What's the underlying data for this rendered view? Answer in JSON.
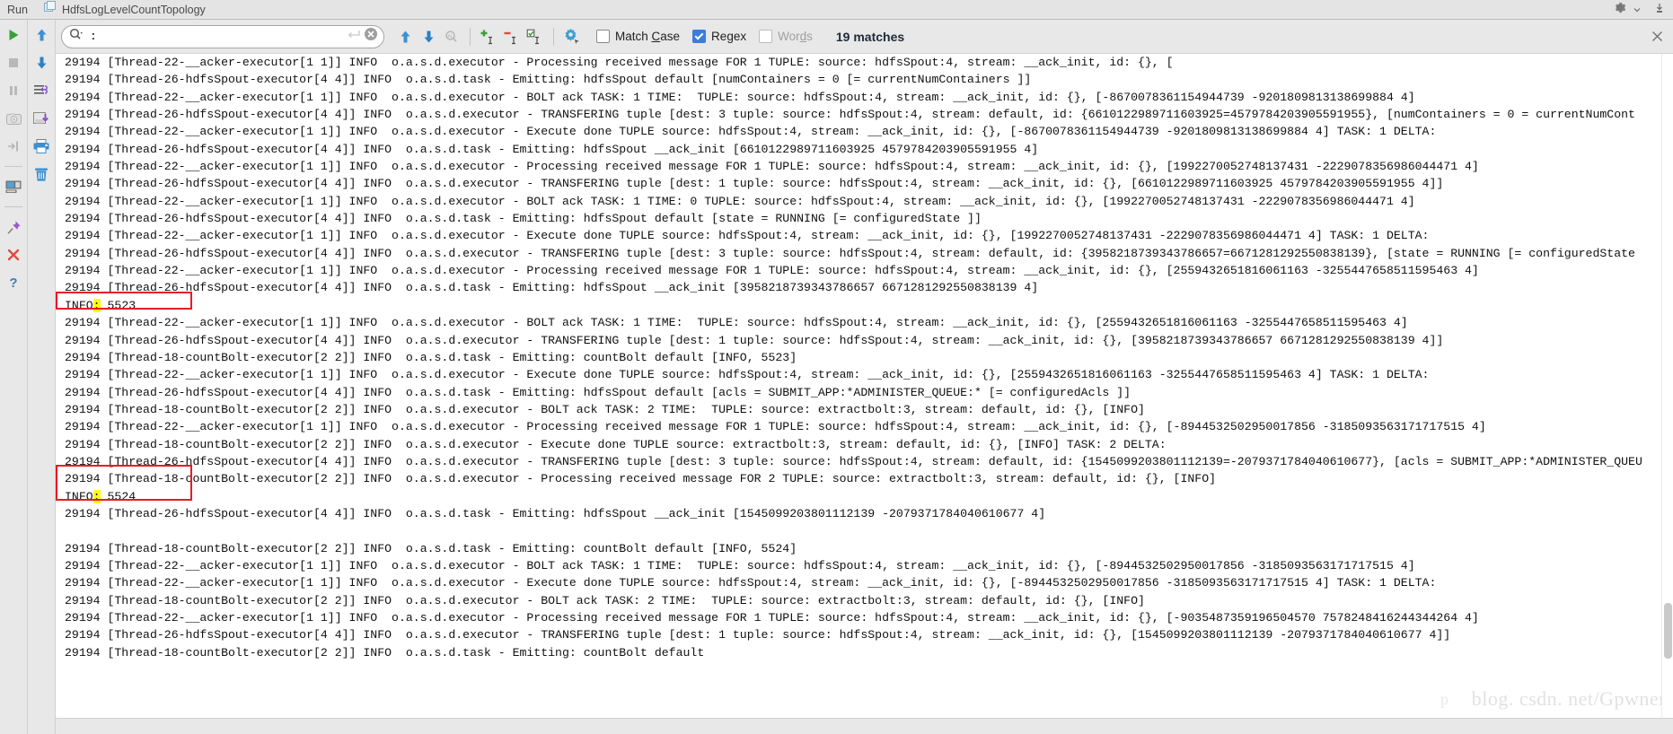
{
  "titlebar": {
    "run_label": "Run",
    "tab_label": "HdfsLogLevelCountTopology",
    "settings_icon": "gear-icon",
    "minimize_icon": "minimize-icon"
  },
  "gutter_primary": {
    "items": [
      {
        "name": "rerun-button",
        "icon": "play-icon",
        "enabled": true
      },
      {
        "name": "stop-button",
        "icon": "stop-icon",
        "enabled": false
      },
      {
        "name": "pause-button",
        "icon": "pause-icon",
        "enabled": false
      },
      {
        "name": "dump-threads-button",
        "icon": "camera-icon",
        "enabled": false
      },
      {
        "name": "resume-program-button",
        "icon": "resume-arrow-icon",
        "enabled": false
      },
      {
        "name": "restore-layout-button",
        "icon": "layout-icon",
        "enabled": true
      },
      {
        "name": "pin-tab-button",
        "icon": "pin-icon",
        "enabled": true
      },
      {
        "name": "close-tab-button",
        "icon": "close-x-icon",
        "enabled": true
      },
      {
        "name": "help-button",
        "icon": "question-mark-icon",
        "enabled": true
      }
    ]
  },
  "gutter_secondary": {
    "items": [
      {
        "name": "scroll-up-button",
        "icon": "arrow-up-icon"
      },
      {
        "name": "scroll-down-button",
        "icon": "arrow-down-icon"
      },
      {
        "name": "soft-wrap-button",
        "icon": "soft-wrap-icon"
      },
      {
        "name": "export-to-file-button",
        "icon": "save-download-icon"
      },
      {
        "name": "print-button",
        "icon": "printer-icon"
      },
      {
        "name": "clear-all-button",
        "icon": "trash-icon"
      }
    ]
  },
  "findbar": {
    "search_icon": "search-magnifier-icon",
    "search_value": ":",
    "search_placeholder": "",
    "enter_icon": "enter-arrow-icon",
    "clear_icon": "clear-circle-icon",
    "prev_icon": "arrow-up-icon",
    "next_icon": "arrow-down-icon",
    "find_all_icon": "find-all-icon",
    "add_line_icon": "add-occurrence-icon",
    "remove_line_icon": "remove-occurrence-icon",
    "select_all_icon": "select-all-occurrences-icon",
    "filter_icon": "gear-filter-icon",
    "checkboxes": [
      {
        "name": "match-case-checkbox",
        "label_pre": "Match ",
        "label_key": "C",
        "label_post": "ase",
        "checked": false,
        "disabled": false
      },
      {
        "name": "regex-checkbox",
        "label_pre": "Re",
        "label_key": "g",
        "label_post": "ex",
        "checked": true,
        "disabled": false
      },
      {
        "name": "words-checkbox",
        "label_pre": "Wor",
        "label_key": "d",
        "label_post": "s",
        "checked": false,
        "disabled": true
      }
    ],
    "matches_text": "19 matches",
    "close_icon": "close-x-icon",
    "accent_color": "#3b7ddd",
    "highlight_color": "#ffff00",
    "box_color": "#e81b23"
  },
  "console": {
    "highlight_color": "#ffff00",
    "box_color": "#e81b23",
    "lines": [
      {
        "text": "29194 [Thread-22-__acker-executor[1 1]] INFO  o.a.s.d.executor - Processing received message FOR 1 TUPLE: source: hdfsSpout:4, stream: __ack_init, id: {}, [",
        "clipped": true
      },
      {
        "text": "29194 [Thread-26-hdfsSpout-executor[4 4]] INFO  o.a.s.d.task - Emitting: hdfsSpout default [numContainers = 0 [= currentNumContainers ]]"
      },
      {
        "text": "29194 [Thread-22-__acker-executor[1 1]] INFO  o.a.s.d.executor - BOLT ack TASK: 1 TIME:  TUPLE: source: hdfsSpout:4, stream: __ack_init, id: {}, [-8670078361154944739 -9201809813138699884 4]"
      },
      {
        "text": "29194 [Thread-26-hdfsSpout-executor[4 4]] INFO  o.a.s.d.executor - TRANSFERING tuple [dest: 3 tuple: source: hdfsSpout:4, stream: default, id: {6610122989711603925=4579784203905591955}, [numContainers = 0 = currentNumCont"
      },
      {
        "text": "29194 [Thread-22-__acker-executor[1 1]] INFO  o.a.s.d.executor - Execute done TUPLE source: hdfsSpout:4, stream: __ack_init, id: {}, [-8670078361154944739 -9201809813138699884 4] TASK: 1 DELTA:"
      },
      {
        "text": "29194 [Thread-26-hdfsSpout-executor[4 4]] INFO  o.a.s.d.task - Emitting: hdfsSpout __ack_init [6610122989711603925 4579784203905591955 4]"
      },
      {
        "text": "29194 [Thread-22-__acker-executor[1 1]] INFO  o.a.s.d.executor - Processing received message FOR 1 TUPLE: source: hdfsSpout:4, stream: __ack_init, id: {}, [1992270052748137431 -2229078356986044471 4]"
      },
      {
        "text": "29194 [Thread-26-hdfsSpout-executor[4 4]] INFO  o.a.s.d.executor - TRANSFERING tuple [dest: 1 tuple: source: hdfsSpout:4, stream: __ack_init, id: {}, [6610122989711603925 4579784203905591955 4]]"
      },
      {
        "text": "29194 [Thread-22-__acker-executor[1 1]] INFO  o.a.s.d.executor - BOLT ack TASK: 1 TIME: 0 TUPLE: source: hdfsSpout:4, stream: __ack_init, id: {}, [1992270052748137431 -2229078356986044471 4]"
      },
      {
        "text": "29194 [Thread-26-hdfsSpout-executor[4 4]] INFO  o.a.s.d.task - Emitting: hdfsSpout default [state = RUNNING [= configuredState ]]"
      },
      {
        "text": "29194 [Thread-22-__acker-executor[1 1]] INFO  o.a.s.d.executor - Execute done TUPLE source: hdfsSpout:4, stream: __ack_init, id: {}, [1992270052748137431 -2229078356986044471 4] TASK: 1 DELTA:"
      },
      {
        "text": "29194 [Thread-26-hdfsSpout-executor[4 4]] INFO  o.a.s.d.executor - TRANSFERING tuple [dest: 3 tuple: source: hdfsSpout:4, stream: default, id: {3958218739343786657=6671281292550838139}, [state = RUNNING [= configuredState"
      },
      {
        "text": "29194 [Thread-22-__acker-executor[1 1]] INFO  o.a.s.d.executor - Processing received message FOR 1 TUPLE: source: hdfsSpout:4, stream: __ack_init, id: {}, [2559432651816061163 -3255447658511595463 4]"
      },
      {
        "text": "29194 [Thread-26-hdfsSpout-executor[4 4]] INFO  o.a.s.d.task - Emitting: hdfsSpout __ack_init [3958218739343786657 6671281292550838139 4]"
      },
      {
        "type": "boxed_info",
        "pre": "INFO",
        "mark": ":",
        "post": " 5523",
        "indent": 0
      },
      {
        "text": "29194 [Thread-22-__acker-executor[1 1]] INFO  o.a.s.d.executor - BOLT ack TASK: 1 TIME:  TUPLE: source: hdfsSpout:4, stream: __ack_init, id: {}, [2559432651816061163 -3255447658511595463 4]"
      },
      {
        "text": "29194 [Thread-26-hdfsSpout-executor[4 4]] INFO  o.a.s.d.executor - TRANSFERING tuple [dest: 1 tuple: source: hdfsSpout:4, stream: __ack_init, id: {}, [3958218739343786657 6671281292550838139 4]]"
      },
      {
        "text": "29194 [Thread-18-countBolt-executor[2 2]] INFO  o.a.s.d.task - Emitting: countBolt default [INFO, 5523]"
      },
      {
        "text": "29194 [Thread-22-__acker-executor[1 1]] INFO  o.a.s.d.executor - Execute done TUPLE source: hdfsSpout:4, stream: __ack_init, id: {}, [2559432651816061163 -3255447658511595463 4] TASK: 1 DELTA:"
      },
      {
        "text": "29194 [Thread-26-hdfsSpout-executor[4 4]] INFO  o.a.s.d.task - Emitting: hdfsSpout default [acls = SUBMIT_APP:*ADMINISTER_QUEUE:* [= configuredAcls ]]"
      },
      {
        "text": "29194 [Thread-18-countBolt-executor[2 2]] INFO  o.a.s.d.executor - BOLT ack TASK: 2 TIME:  TUPLE: source: extractbolt:3, stream: default, id: {}, [INFO]"
      },
      {
        "text": "29194 [Thread-22-__acker-executor[1 1]] INFO  o.a.s.d.executor - Processing received message FOR 1 TUPLE: source: hdfsSpout:4, stream: __ack_init, id: {}, [-8944532502950017856 -3185093563171717515 4]"
      },
      {
        "text": "29194 [Thread-18-countBolt-executor[2 2]] INFO  o.a.s.d.executor - Execute done TUPLE source: extractbolt:3, stream: default, id: {}, [INFO] TASK: 2 DELTA:"
      },
      {
        "text": "29194 [Thread-26-hdfsSpout-executor[4 4]] INFO  o.a.s.d.executor - TRANSFERING tuple [dest: 3 tuple: source: hdfsSpout:4, stream: default, id: {1545099203801112139=-2079371784040610677}, [acls = SUBMIT_APP:*ADMINISTER_QUEU"
      },
      {
        "type": "boxed_line2a",
        "text": "29194 [Thread-18-countBolt-executor[2 2]] INFO  o.a.s.d.executor - Processing received message FOR 2 TUPLE: source: extractbolt:3, stream: default, id: {}, [INFO]"
      },
      {
        "type": "boxed_info",
        "pre": "INFO",
        "mark": ":",
        "post": " 5524",
        "indent": 0
      },
      {
        "text": "29194 [Thread-26-hdfsSpout-executor[4 4]] INFO  o.a.s.d.task - Emitting: hdfsSpout __ack_init [1545099203801112139 -2079371784040610677 4]"
      },
      {
        "text": ""
      },
      {
        "text": "29194 [Thread-18-countBolt-executor[2 2]] INFO  o.a.s.d.task - Emitting: countBolt default [INFO, 5524]"
      },
      {
        "text": "29194 [Thread-22-__acker-executor[1 1]] INFO  o.a.s.d.executor - BOLT ack TASK: 1 TIME:  TUPLE: source: hdfsSpout:4, stream: __ack_init, id: {}, [-8944532502950017856 -3185093563171717515 4]"
      },
      {
        "text": "29194 [Thread-22-__acker-executor[1 1]] INFO  o.a.s.d.executor - Execute done TUPLE source: hdfsSpout:4, stream: __ack_init, id: {}, [-8944532502950017856 -3185093563171717515 4] TASK: 1 DELTA:"
      },
      {
        "text": "29194 [Thread-18-countBolt-executor[2 2]] INFO  o.a.s.d.executor - BOLT ack TASK: 2 TIME:  TUPLE: source: extractbolt:3, stream: default, id: {}, [INFO]"
      },
      {
        "text": "29194 [Thread-22-__acker-executor[1 1]] INFO  o.a.s.d.executor - Processing received message FOR 1 TUPLE: source: hdfsSpout:4, stream: __ack_init, id: {}, [-9035487359196504570 7578248416244344264 4]"
      },
      {
        "text": "29194 [Thread-26-hdfsSpout-executor[4 4]] INFO  o.a.s.d.executor - TRANSFERING tuple [dest: 1 tuple: source: hdfsSpout:4, stream: __ack_init, id: {}, [1545099203801112139 -2079371784040610677 4]]"
      },
      {
        "text": "29194 [Thread-18-countBolt-executor[2 2]] INFO  o.a.s.d.task - Emitting: countBolt default",
        "clipped_bottom": true
      }
    ]
  },
  "watermark": {
    "text": "blog. csdn. net/Gpwner",
    "secondary": "p"
  }
}
